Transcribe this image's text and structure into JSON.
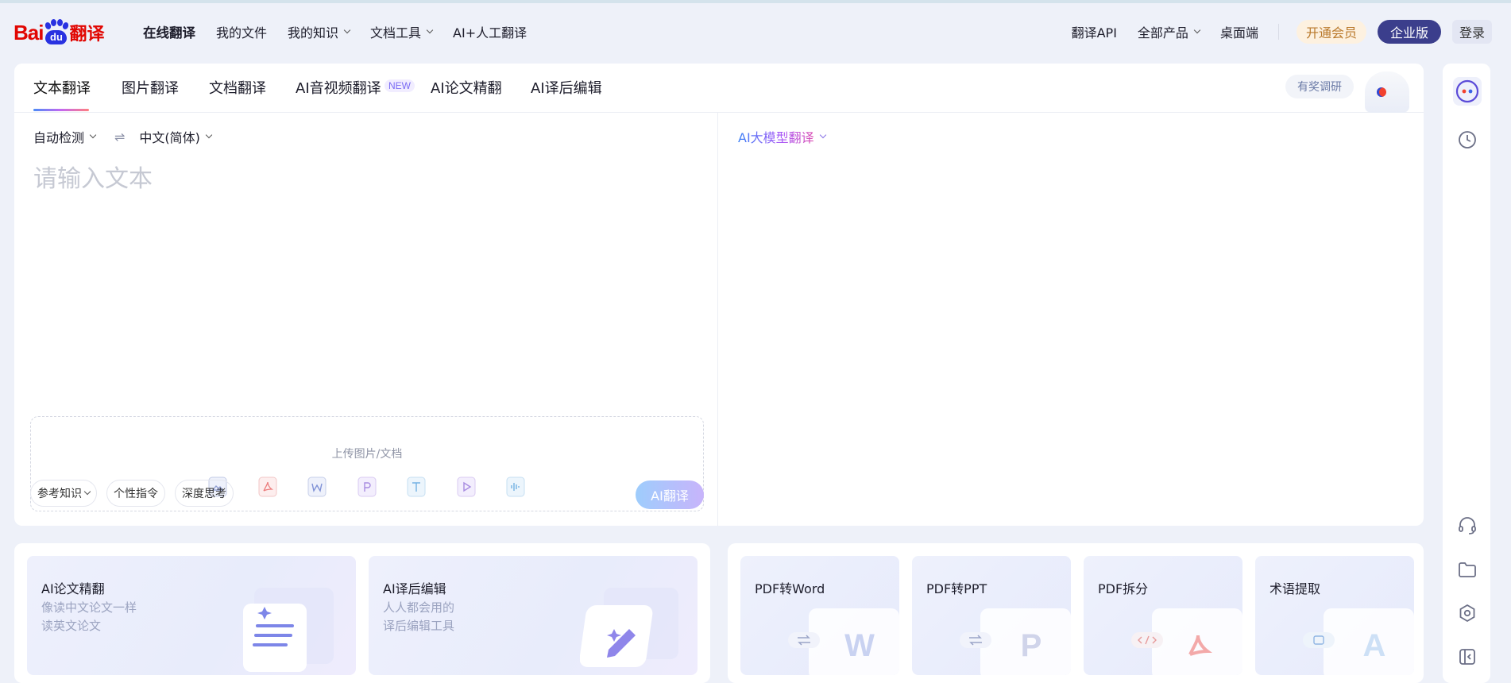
{
  "header": {
    "logo_text_latin": "Bai",
    "logo_text_paw": "du",
    "logo_text_cn": "翻译",
    "nav": [
      {
        "label": "在线翻译",
        "active": true,
        "dropdown": false
      },
      {
        "label": "我的文件",
        "active": false,
        "dropdown": false
      },
      {
        "label": "我的知识",
        "active": false,
        "dropdown": true
      },
      {
        "label": "文档工具",
        "active": false,
        "dropdown": true
      },
      {
        "label": "AI+人工翻译",
        "active": false,
        "dropdown": false
      }
    ],
    "right": {
      "api": "翻译API",
      "all_products": "全部产品",
      "desktop": "桌面端",
      "vip": "开通会员",
      "enterprise": "企业版",
      "login": "登录"
    }
  },
  "tabs": [
    {
      "label": "文本翻译",
      "active": true
    },
    {
      "label": "图片翻译",
      "active": false
    },
    {
      "label": "文档翻译",
      "active": false
    },
    {
      "label": "AI音视频翻译",
      "active": false
    },
    {
      "label": "AI论文精翻",
      "active": false
    },
    {
      "label": "AI译后编辑",
      "active": false
    }
  ],
  "new_badge": "NEW",
  "survey": "有奖调研",
  "source": {
    "from_lang": "自动检测",
    "to_lang": "中文(简体)",
    "placeholder": "请输入文本",
    "upload_label": "上传图片/文档",
    "file_types": [
      "image-icon",
      "pdf-icon",
      "word-icon",
      "ppt-icon",
      "txt-icon",
      "video-icon",
      "audio-icon"
    ],
    "options": [
      "参考知识",
      "个性指令",
      "深度思考"
    ],
    "translate_button": "AI翻译"
  },
  "target": {
    "model": "AI大模型翻译"
  },
  "feature_cards": [
    {
      "title": "AI论文精翻",
      "desc": [
        "像读中文论文一样",
        "读英文论文"
      ]
    },
    {
      "title": "AI译后编辑",
      "desc": [
        "人人都会用的",
        "译后编辑工具"
      ]
    }
  ],
  "tool_cards": [
    {
      "title": "PDF转Word",
      "letter": "W"
    },
    {
      "title": "PDF转PPT",
      "letter": "P"
    },
    {
      "title": "PDF拆分",
      "letter": ""
    },
    {
      "title": "术语提取",
      "letter": "A"
    }
  ],
  "colors": {
    "brand_red": "#e10602",
    "brand_blue": "#2932e1",
    "enterprise_bg": "#3b3e8c",
    "vip_text": "#b9782a"
  }
}
